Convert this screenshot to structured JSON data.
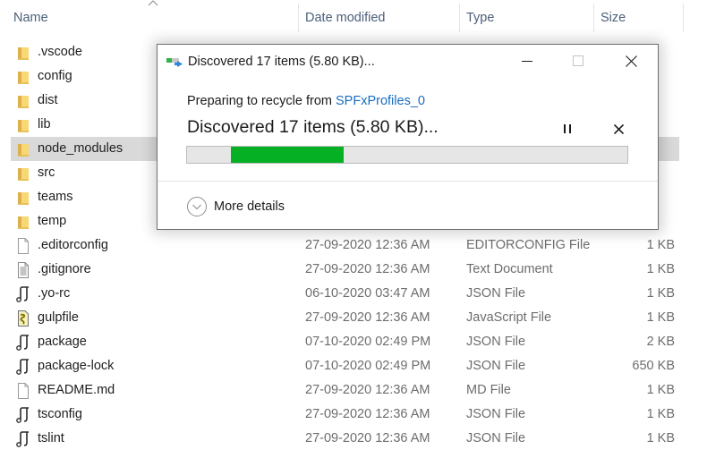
{
  "columns": {
    "name": "Name",
    "date_modified": "Date modified",
    "type": "Type",
    "size": "Size",
    "sort_icon": "chevron-up-icon"
  },
  "files": [
    {
      "name": ".vscode",
      "icon": "folder-icon",
      "date": "",
      "type": "",
      "size": ""
    },
    {
      "name": "config",
      "icon": "folder-icon",
      "date": "",
      "type": "",
      "size": ""
    },
    {
      "name": "dist",
      "icon": "folder-icon",
      "date": "",
      "type": "",
      "size": ""
    },
    {
      "name": "lib",
      "icon": "folder-icon",
      "date": "",
      "type": "",
      "size": ""
    },
    {
      "name": "node_modules",
      "icon": "folder-icon",
      "date": "",
      "type": "",
      "size": "",
      "selected": true
    },
    {
      "name": "src",
      "icon": "folder-icon",
      "date": "",
      "type": "",
      "size": ""
    },
    {
      "name": "teams",
      "icon": "folder-icon",
      "date": "",
      "type": "",
      "size": ""
    },
    {
      "name": "temp",
      "icon": "folder-icon",
      "date": "",
      "type": "",
      "size": ""
    },
    {
      "name": ".editorconfig",
      "icon": "blank-file-icon",
      "date": "27-09-2020 12:36 AM",
      "type": "EDITORCONFIG File",
      "size": "1 KB"
    },
    {
      "name": ".gitignore",
      "icon": "text-file-icon",
      "date": "27-09-2020 12:36 AM",
      "type": "Text Document",
      "size": "1 KB"
    },
    {
      "name": ".yo-rc",
      "icon": "json-file-icon",
      "date": "06-10-2020 03:47 AM",
      "type": "JSON File",
      "size": "1 KB"
    },
    {
      "name": "gulpfile",
      "icon": "javascript-file-icon",
      "date": "27-09-2020 12:36 AM",
      "type": "JavaScript File",
      "size": "1 KB"
    },
    {
      "name": "package",
      "icon": "json-file-icon",
      "date": "07-10-2020 02:49 PM",
      "type": "JSON File",
      "size": "2 KB"
    },
    {
      "name": "package-lock",
      "icon": "json-file-icon",
      "date": "07-10-2020 02:49 PM",
      "type": "JSON File",
      "size": "650 KB"
    },
    {
      "name": "README.md",
      "icon": "blank-file-icon",
      "date": "27-09-2020 12:36 AM",
      "type": "MD File",
      "size": "1 KB"
    },
    {
      "name": "tsconfig",
      "icon": "json-file-icon",
      "date": "27-09-2020 12:36 AM",
      "type": "JSON File",
      "size": "1 KB"
    },
    {
      "name": "tslint",
      "icon": "json-file-icon",
      "date": "27-09-2020 12:36 AM",
      "type": "JSON File",
      "size": "1 KB"
    }
  ],
  "dialog": {
    "title": "Discovered 17 items (5.80 KB)...",
    "title_icon": "recycle-progress-icon",
    "minimize_icon": "minimize-icon",
    "maximize_icon": "maximize-icon",
    "close_icon": "close-icon",
    "prep_prefix": "Preparing to recycle from ",
    "prep_source": "SPFxProfiles_0",
    "status": "Discovered 17 items (5.80 KB)...",
    "pause_icon": "pause-icon",
    "cancel_icon": "cancel-icon",
    "progress": {
      "start": 0.1,
      "end": 0.355,
      "color": "#06b025",
      "indeterminate": true
    },
    "more_details": "More details",
    "more_details_icon": "chevron-down-circle-icon"
  }
}
